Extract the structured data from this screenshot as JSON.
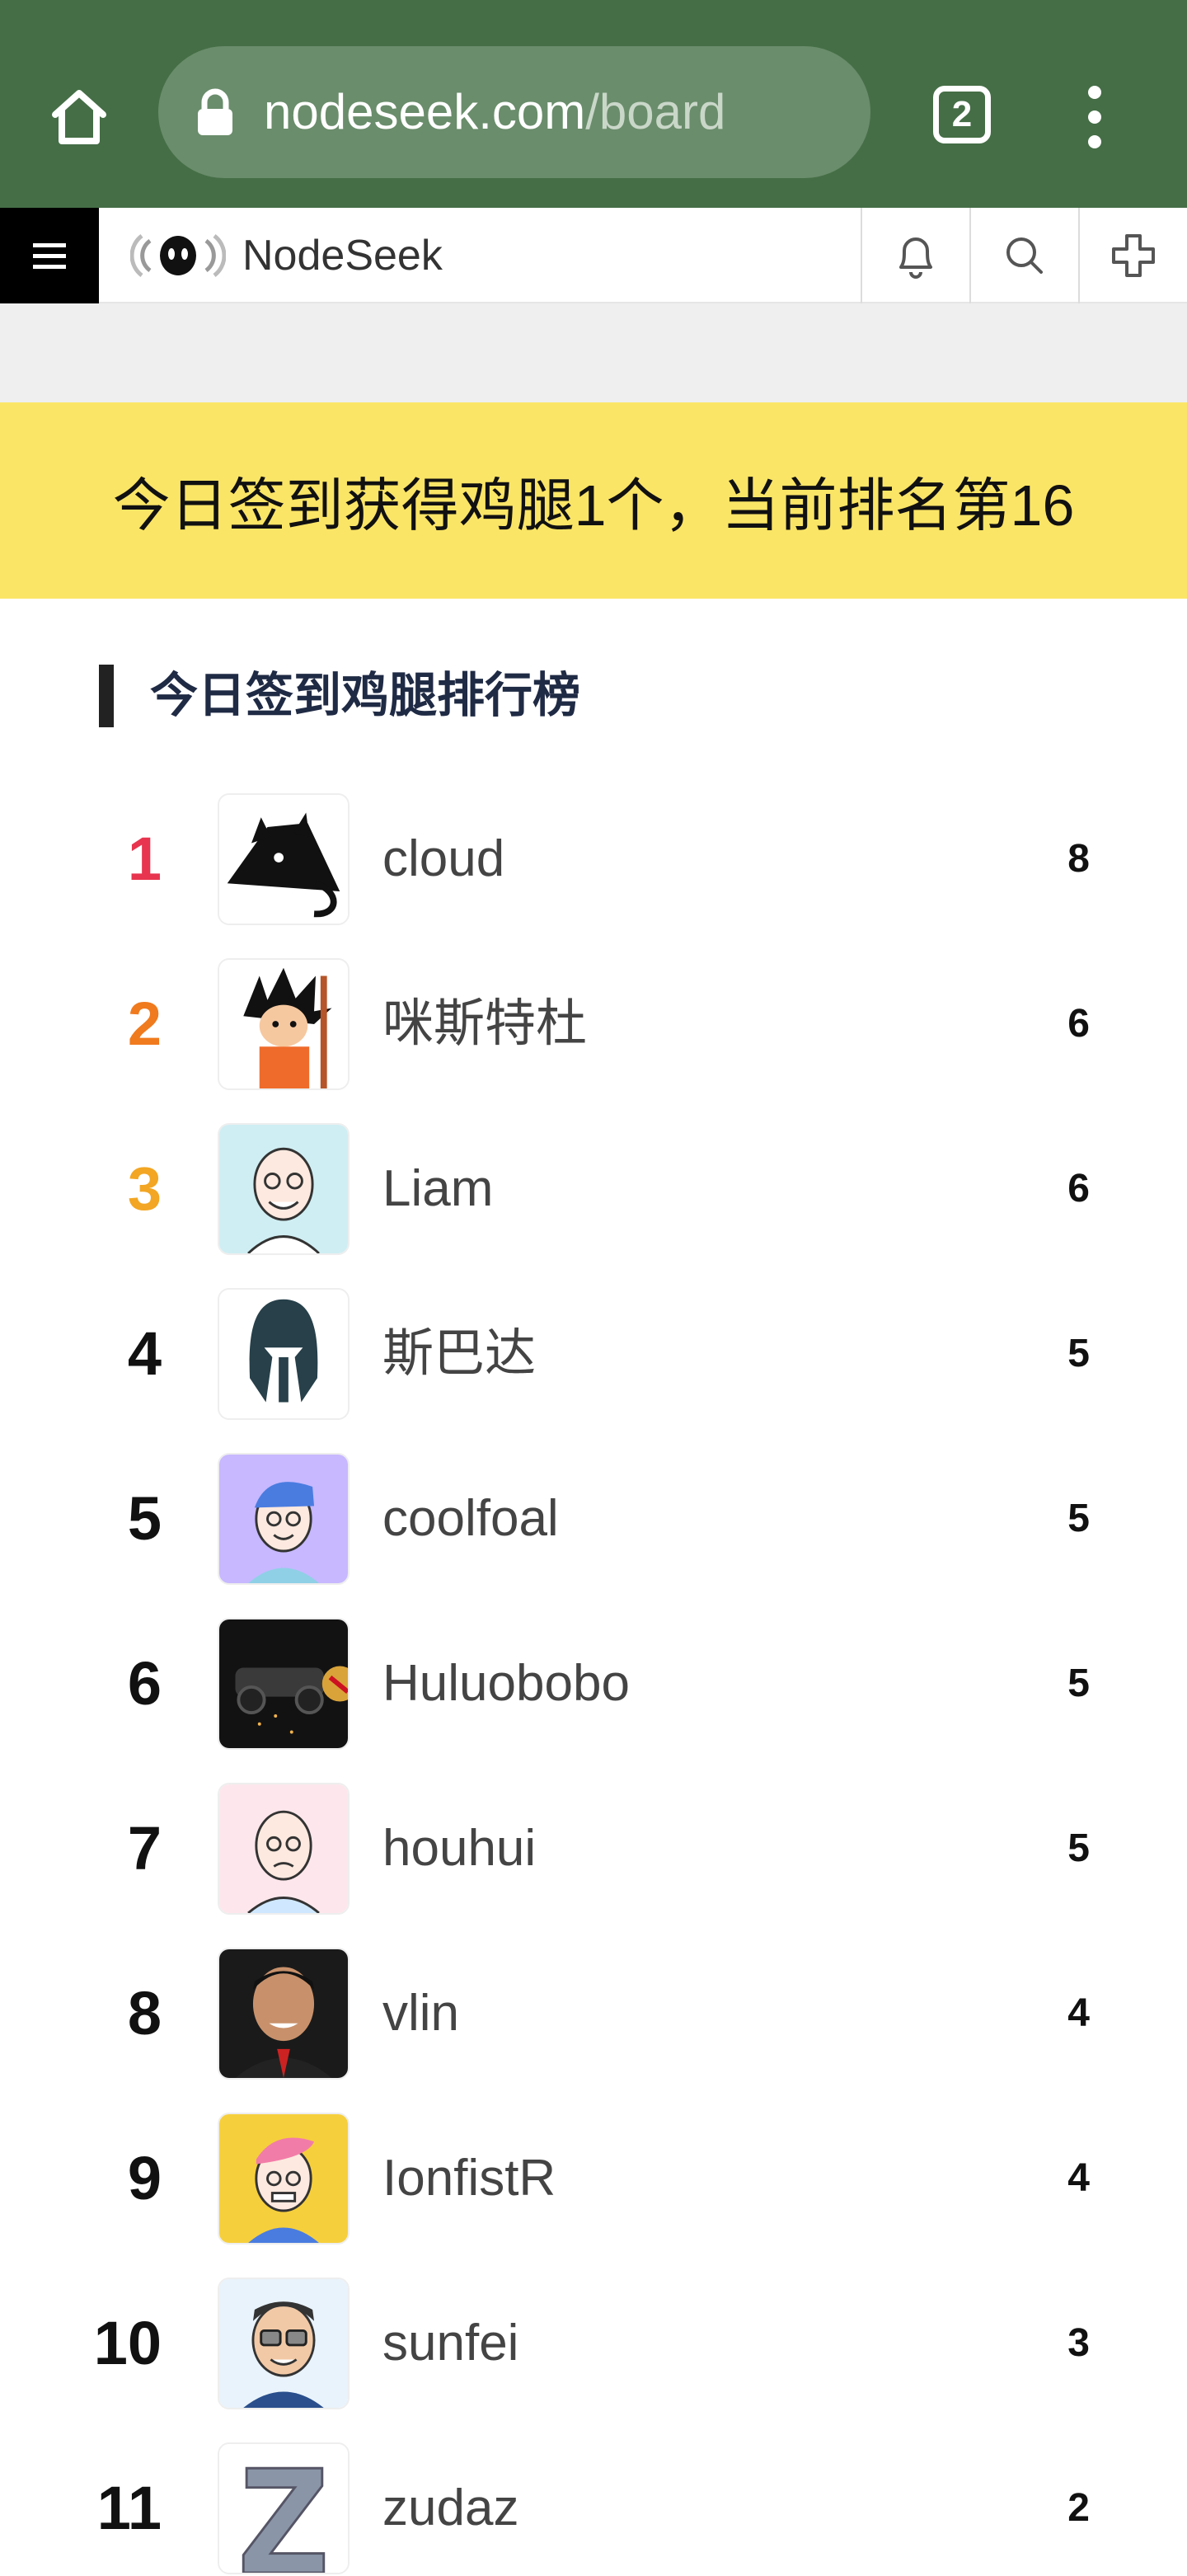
{
  "browser": {
    "url_host": "nodeseek.com",
    "url_path": "/board",
    "tab_count": "2"
  },
  "header": {
    "brand": "NodeSeek"
  },
  "notice": {
    "text": "今日签到获得鸡腿1个，当前排名第16"
  },
  "leaderboard": {
    "title": "今日签到鸡腿排行榜",
    "rank_colors": {
      "1": "#e8344e",
      "2": "#f07a1e",
      "3": "#f2a623"
    },
    "rows": [
      {
        "rank": "1",
        "name": "cloud",
        "score": "8",
        "avatar": "dark-bird-avatar"
      },
      {
        "rank": "2",
        "name": "咪斯特杜",
        "score": "6",
        "avatar": "anime-boy-avatar"
      },
      {
        "rank": "3",
        "name": "Liam",
        "score": "6",
        "avatar": "cartoon-man-avatar"
      },
      {
        "rank": "4",
        "name": "斯巴达",
        "score": "5",
        "avatar": "spartan-helmet-avatar"
      },
      {
        "rank": "5",
        "name": "coolfoal",
        "score": "5",
        "avatar": "cartoon-purple-avatar"
      },
      {
        "rank": "6",
        "name": "Huluobobo",
        "score": "5",
        "avatar": "racecar-photo-avatar"
      },
      {
        "rank": "7",
        "name": "houhui",
        "score": "5",
        "avatar": "cartoon-pink-avatar"
      },
      {
        "rank": "8",
        "name": "vlin",
        "score": "4",
        "avatar": "man-photo-avatar"
      },
      {
        "rank": "9",
        "name": "IonfistR",
        "score": "4",
        "avatar": "cartoon-yellow-avatar"
      },
      {
        "rank": "10",
        "name": "sunfei",
        "score": "3",
        "avatar": "cartoon-glasses-avatar"
      },
      {
        "rank": "11",
        "name": "zudaz",
        "score": "2",
        "avatar": "letter-z-avatar"
      }
    ]
  }
}
